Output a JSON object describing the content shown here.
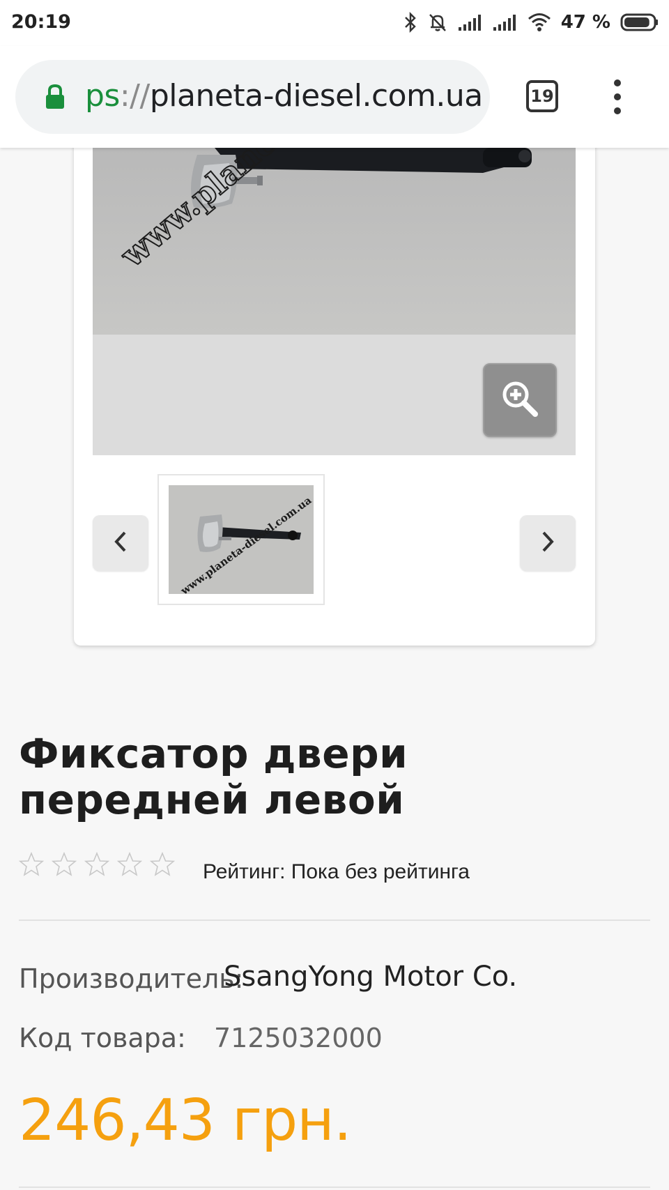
{
  "status_bar": {
    "time": "20:19",
    "battery_percent": "47 %",
    "icons": [
      "bluetooth-icon",
      "notifications-off-icon",
      "signal-icon",
      "signal-icon",
      "wifi-icon",
      "battery-icon"
    ],
    "battery_level": 0.47
  },
  "browser": {
    "url_scheme": "ps",
    "url_separator": "://",
    "url_host": "planeta-diesel.com.ua",
    "tab_count": "19",
    "lock_color": "#1a8f3c"
  },
  "gallery": {
    "watermark": "www.planeta-diesel.com.ua",
    "icons": [
      "zoom-in-icon",
      "chevron-left-icon",
      "chevron-right-icon"
    ]
  },
  "product": {
    "title": "Фиксатор двери передней левой",
    "rating_stars": 5,
    "rating_filled": 0,
    "rating_label": "Рейтинг: Пока без рейтинга",
    "manufacturer_label": "Производитель:",
    "manufacturer_value": "SsangYong Motor Co.",
    "sku_label": "Код товара:",
    "sku_value": "7125032000",
    "price": "246,43 грн.",
    "price_color": "#f5a00f"
  }
}
